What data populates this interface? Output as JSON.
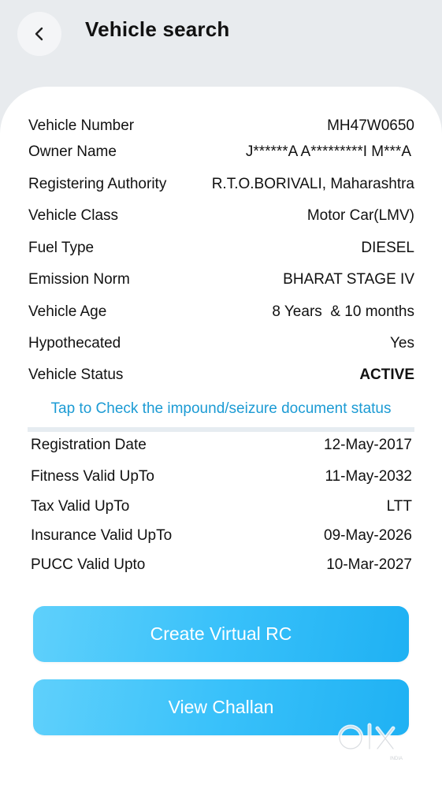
{
  "header": {
    "title": "Vehicle search"
  },
  "details": [
    {
      "label": "Vehicle Number",
      "value": "MH47W0650"
    },
    {
      "label": "Owner Name",
      "value": "J******A A*********I M***A"
    },
    {
      "label": "Registering Authority",
      "value": "R.T.O.BORIVALI, Maharashtra"
    },
    {
      "label": "Vehicle Class",
      "value": "Motor Car(LMV)"
    },
    {
      "label": "Fuel Type",
      "value": "DIESEL"
    },
    {
      "label": "Emission Norm",
      "value": "BHARAT STAGE IV"
    },
    {
      "label": "Vehicle Age",
      "value": "8 Years  & 10 months"
    },
    {
      "label": "Hypothecated",
      "value": "Yes"
    },
    {
      "label": "Vehicle Status",
      "value": "ACTIVE"
    }
  ],
  "status_color": "#2ebd49",
  "impound_link": "Tap to Check the impound/seizure document status",
  "validity": [
    {
      "label": "Registration Date",
      "value": "12-May-2017"
    },
    {
      "label": "Fitness Valid UpTo",
      "value": "11-May-2032"
    },
    {
      "label": "Tax Valid UpTo",
      "value": "LTT"
    },
    {
      "label": "Insurance Valid UpTo",
      "value": "09-May-2026"
    },
    {
      "label": "PUCC Valid Upto",
      "value": "10-Mar-2027"
    }
  ],
  "buttons": {
    "virtual_rc": "Create Virtual RC",
    "challan": "View Challan"
  },
  "accent_color": "#39c1fa",
  "watermark": {
    "brand": "OLX",
    "sub": "INDIA"
  }
}
